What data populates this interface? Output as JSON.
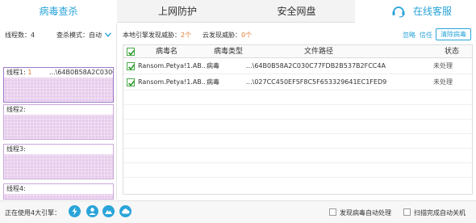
{
  "nav": {
    "tabs": [
      "病毒查杀",
      "上网防护",
      "安全网盘"
    ],
    "support_label": "在线客服",
    "accent": "#2aa4d9"
  },
  "left": {
    "thread_count_label": "线程数：4",
    "scan_mode_label": "查杀模式：自动",
    "threads": [
      {
        "label": "线程1:",
        "num": "1",
        "path": "...\\64B0B58A2C030C"
      },
      {
        "label": "线程2:",
        "num": "",
        "path": ""
      },
      {
        "label": "线程3:",
        "num": "",
        "path": ""
      },
      {
        "label": "线程4:",
        "num": "",
        "path": ""
      }
    ]
  },
  "right": {
    "local_label": "本地引擎发现威胁：",
    "local_count": "2个",
    "cloud_label": "云发现威胁：",
    "cloud_count": "0个",
    "ignore_label": "忽略",
    "trust_label": "信任",
    "clear_label": "清除病毒",
    "headers": {
      "name": "病毒名",
      "type": "病毒类型",
      "path": "文件路径",
      "status": "状态"
    },
    "rows": [
      {
        "name": "Ransom.Petya!1.AB...",
        "type": "病毒",
        "path": "...\\64B0B58A2C030C77FDB2B537B2FCC4A",
        "status": "未处理"
      },
      {
        "name": "Ransom.Petya!1.AB...",
        "type": "病毒",
        "path": "...\\027CC450EF5F8C5F653329641EC1FED9",
        "status": "未处理"
      }
    ]
  },
  "footer": {
    "engines_label": "正在使用4大引擎：",
    "opt_auto": "发现病毒自动处理",
    "opt_shutdown": "扫描完成自动关机"
  }
}
